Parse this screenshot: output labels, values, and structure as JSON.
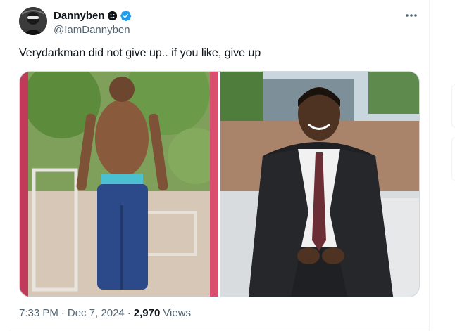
{
  "author": {
    "display_name": "Dannyben",
    "name_emoji": "smiling-face-emoji",
    "verified": true,
    "handle": "@IamDannyben",
    "avatar": "profile-photo"
  },
  "tweet": {
    "text": "Verydarkman did not give up.. if you like, give up",
    "more_icon": "more-horizontal-icon",
    "media": [
      {
        "name": "photo-before",
        "description_icon": "image"
      },
      {
        "name": "photo-after",
        "description_icon": "image"
      }
    ],
    "time": "7:33 PM",
    "separator": "·",
    "date": "Dec 7, 2024",
    "views_count": "2,970",
    "views_label": "Views"
  },
  "colors": {
    "text_primary": "#0f1419",
    "text_secondary": "#536471",
    "verified_blue": "#1d9bf0",
    "border": "#cfd9de"
  }
}
